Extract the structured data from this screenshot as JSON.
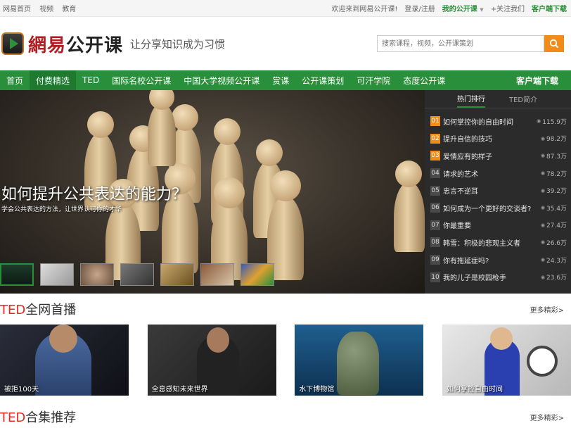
{
  "topbar": {
    "left_links": [
      "网易首页",
      "视频",
      "教育"
    ],
    "welcome": "欢迎来到网易公开课!",
    "login": "登录/注册",
    "my_course": "我的公开课",
    "follow": "+关注我们",
    "client_download": "客户端下载"
  },
  "header": {
    "brand": "網易",
    "brand_suffix": "公开课",
    "slogan": "让分享知识成为习惯",
    "search_placeholder": "搜索课程，视频，公开课策划"
  },
  "nav": {
    "items": [
      "首页",
      "付费精选",
      "TED",
      "国际名校公开课",
      "中国大学视频公开课",
      "赏课",
      "公开课策划",
      "可汗学院",
      "态度公开课"
    ],
    "download": "客户端下载"
  },
  "hero": {
    "title": "如何提升公共表达的能力？",
    "subtitle": "学会公共表达的方法，让世界认可你的才华"
  },
  "ranking": {
    "tabs": [
      "热门排行",
      "TED简介"
    ],
    "items": [
      {
        "num": "01",
        "name": "如何掌控你的自由时间",
        "count": "115.9万"
      },
      {
        "num": "02",
        "name": "提升自信的技巧",
        "count": "98.2万"
      },
      {
        "num": "03",
        "name": "爱情应有的样子",
        "count": "87.3万"
      },
      {
        "num": "04",
        "name": "请求的艺术",
        "count": "78.2万"
      },
      {
        "num": "05",
        "name": "忠言不逆耳",
        "count": "39.2万"
      },
      {
        "num": "06",
        "name": "如何成为一个更好的交谈者?",
        "count": "35.4万"
      },
      {
        "num": "07",
        "name": "你最重要",
        "count": "27.4万"
      },
      {
        "num": "08",
        "name": "韩雪：积极的悲观主义者",
        "count": "26.6万"
      },
      {
        "num": "09",
        "name": "你有拖延症吗?",
        "count": "24.3万"
      },
      {
        "num": "10",
        "name": "我的儿子是校园枪手",
        "count": "23.6万"
      }
    ]
  },
  "section1": {
    "ted": "TED",
    "title": "全网首播",
    "more": "更多精彩>",
    "cards": [
      "被拒100天",
      "全息感知未来世界",
      "水下博物馆",
      "如何掌控自由时间"
    ]
  },
  "section2": {
    "ted": "TED",
    "title": "合集推荐",
    "more": "更多精彩>"
  },
  "colors": {
    "accent_green": "#2a8f3a",
    "accent_orange": "#f08c1a",
    "brand_red": "#b01e23",
    "ted_red": "#e62b1e"
  }
}
